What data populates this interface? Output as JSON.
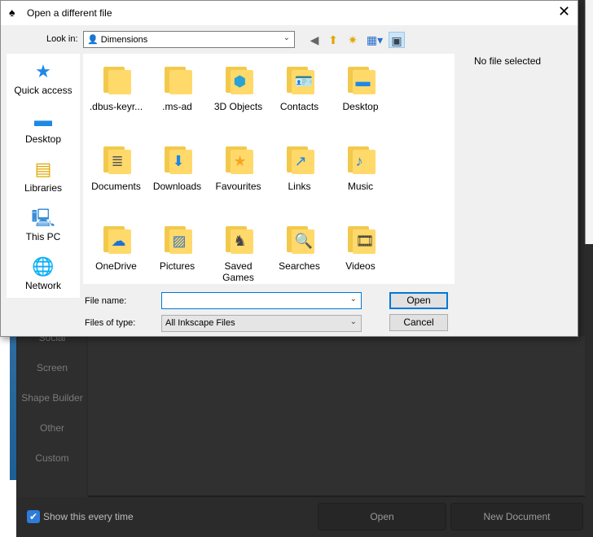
{
  "background": {
    "sidebar": [
      "Social",
      "Screen",
      "Shape Builder",
      "Other",
      "Custom"
    ],
    "show_every_time": "Show this every time",
    "open": "Open",
    "new_document": "New Document"
  },
  "dialog": {
    "title": "Open a different file",
    "look_in_label": "Look in:",
    "look_in_value": "Dimensions",
    "no_file": "No file selected",
    "places": [
      "Quick access",
      "Desktop",
      "Libraries",
      "This PC",
      "Network"
    ],
    "files": [
      ".dbus-keyr...",
      ".ms-ad",
      "3D Objects",
      "Contacts",
      "Desktop",
      "Documents",
      "Downloads",
      "Favourites",
      "Links",
      "Music",
      "OneDrive",
      "Pictures",
      "Saved Games",
      "Searches",
      "Videos"
    ],
    "file_name_label": "File name:",
    "file_name_value": "",
    "files_of_type_label": "Files of type:",
    "files_of_type_value": "All Inkscape Files",
    "open": "Open",
    "cancel": "Cancel"
  }
}
